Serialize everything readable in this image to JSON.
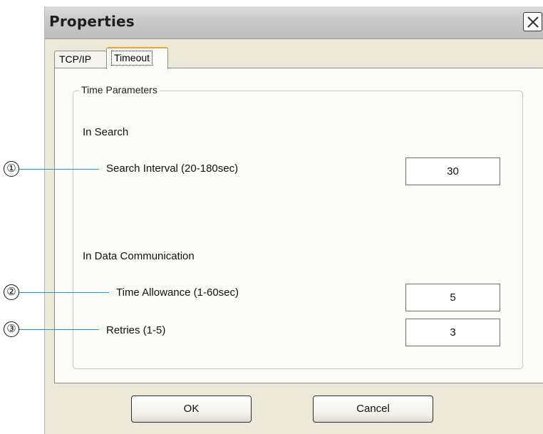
{
  "dialog": {
    "title": "Properties",
    "close_icon": "close-x-icon"
  },
  "tabs": [
    {
      "label": "TCP/IP",
      "selected": false
    },
    {
      "label": "Timeout",
      "selected": true
    }
  ],
  "group": {
    "label": "Time Parameters",
    "sections": {
      "search": "In Search",
      "data": "In Data Communication"
    },
    "fields": {
      "search_interval": {
        "label": "Search Interval (20-180sec)",
        "value": "30"
      },
      "time_allowance": {
        "label": "Time Allowance (1-60sec)",
        "value": "5"
      },
      "retries": {
        "label": "Retries (1-5)",
        "value": "3"
      }
    }
  },
  "buttons": {
    "ok": "OK",
    "cancel": "Cancel"
  },
  "callouts": [
    "①",
    "②",
    "③"
  ],
  "colors": {
    "callout_line": "#1996d6",
    "dialog_bg": "#ece9d8",
    "tab_focus": "#e6a33c"
  }
}
